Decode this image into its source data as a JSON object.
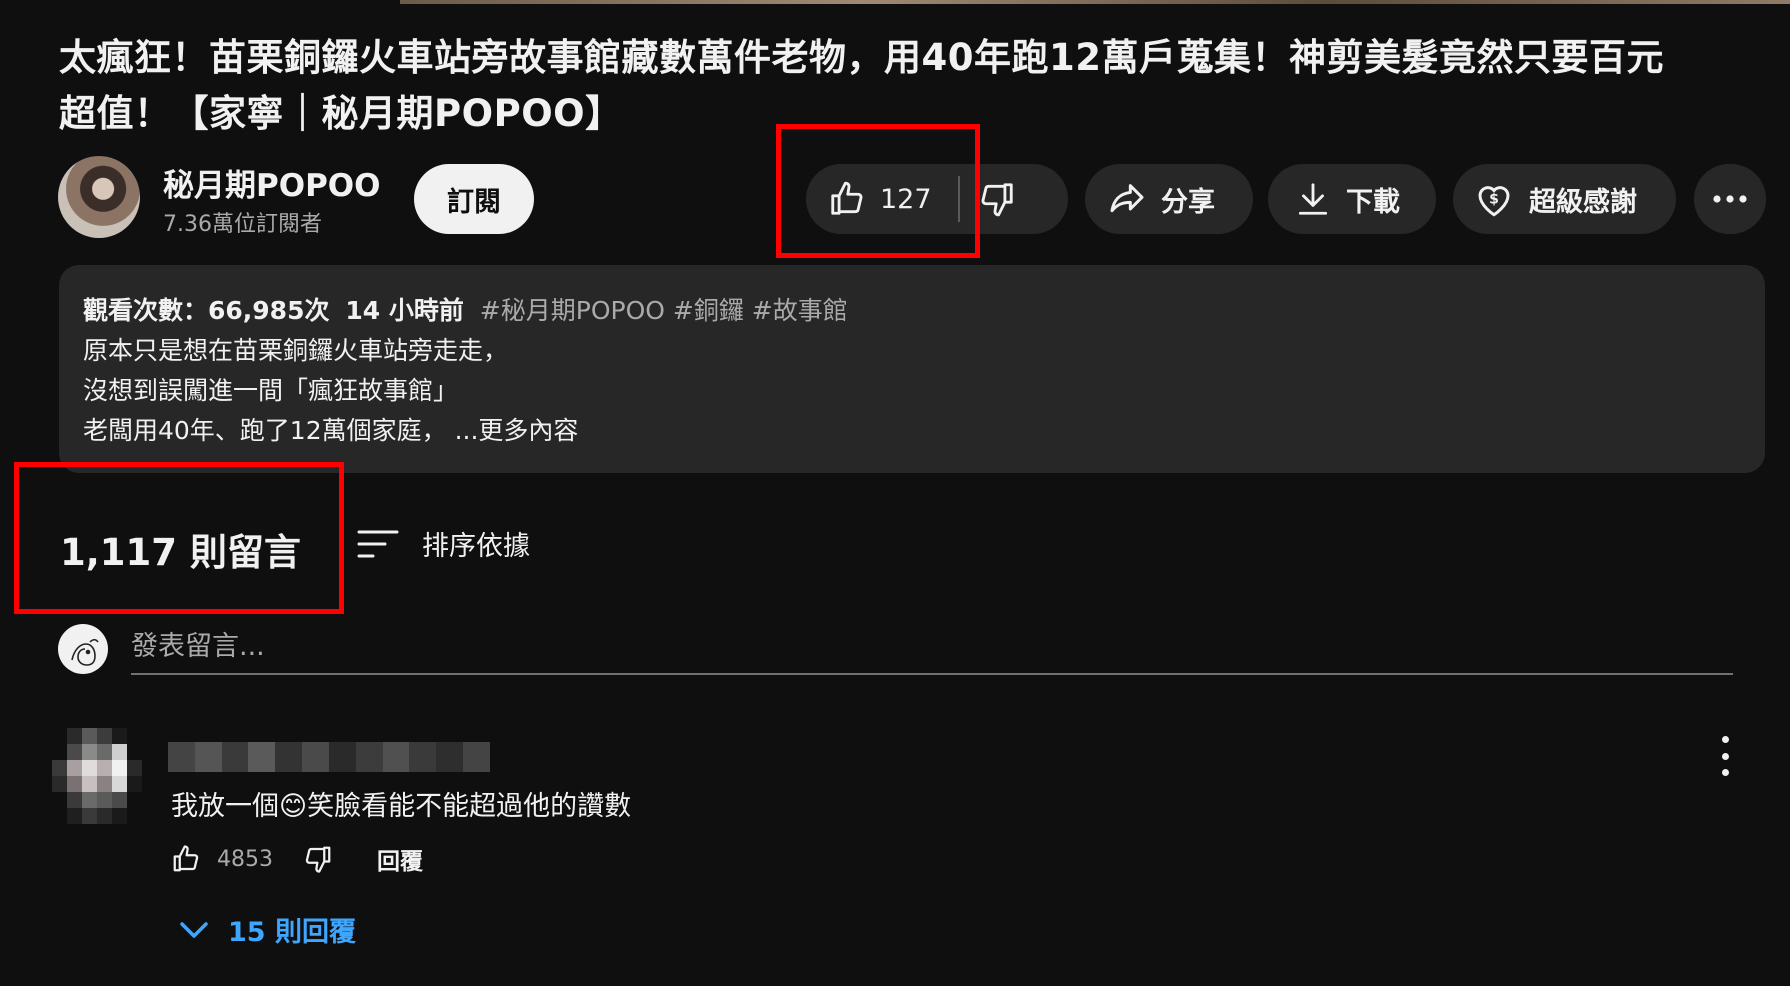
{
  "video": {
    "title_line1": "太瘋狂！苗栗銅鑼火車站旁故事館藏數萬件老物，用40年跑12萬戶蒐集！神剪美髮竟然只要百元",
    "title_line2": "超值！【家寧｜秘月期POPOO】"
  },
  "channel": {
    "name": "秘月期POPOO",
    "subscribers": "7.36萬位訂閱者",
    "subscribe_label": "訂閱"
  },
  "actions": {
    "like_count": "127",
    "share_label": "分享",
    "download_label": "下載",
    "thanks_label": "超級感謝"
  },
  "description": {
    "views": "觀看次數：66,985次",
    "time": "14 小時前",
    "tags": "#秘月期POPOO #銅鑼 #故事館",
    "line1": "原本只是想在苗栗銅鑼火車站旁走走，",
    "line2": "沒想到誤闖進一間「瘋狂故事館」",
    "line3": "老闆用40年、跑了12萬個家庭，",
    "more_label": "...更多內容"
  },
  "comments": {
    "count_label": "1,117 則留言",
    "sort_label": "排序依據",
    "input_placeholder": "發表留言...",
    "items": [
      {
        "text_before": "我放一個",
        "emoji": "😊",
        "text_after": "笑臉看能不能超過他的讚數",
        "likes": "4853",
        "reply_label": "回覆",
        "replies_label": "15 則回覆"
      }
    ]
  },
  "colors": {
    "background": "#0f0f0f",
    "pill": "#272727",
    "highlight_box": "#ff0000",
    "link_blue": "#3ea6ff"
  },
  "icons": [
    "thumb-up-icon",
    "thumb-down-icon",
    "share-arrow-icon",
    "download-icon",
    "heart-dollar-icon",
    "more-horizontal-icon",
    "sort-icon",
    "chevron-down-icon",
    "more-vertical-icon"
  ]
}
